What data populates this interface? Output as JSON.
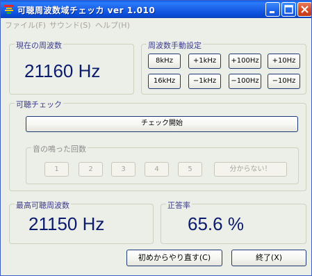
{
  "window": {
    "title": "可聴周波数域チェッカ ver 1.010"
  },
  "menu": [
    "ファイル(F)",
    "サウンド(S)",
    "ヘルプ(H)"
  ],
  "current_freq": {
    "label": "現在の周波数",
    "value": "21160 Hz"
  },
  "manual_freq": {
    "label": "周波数手動設定",
    "buttons": [
      "8kHz",
      "+1kHz",
      "+100Hz",
      "+10Hz",
      "16kHz",
      "−1kHz",
      "−100Hz",
      "−10Hz"
    ]
  },
  "audible_check": {
    "label": "可聴チェック",
    "start_button": "チェック開始",
    "count_group": {
      "label": "音の鳴った回数",
      "buttons": [
        "1",
        "2",
        "3",
        "4",
        "5"
      ],
      "unknown_button": "分からない！"
    }
  },
  "max_freq": {
    "label": "最高可聴周波数",
    "value": "21150 Hz"
  },
  "accuracy": {
    "label": "正答率",
    "value": "65.6 %"
  },
  "footer": {
    "restart_button": "初めからやり直す(C)",
    "exit_button": "終了(X)"
  }
}
